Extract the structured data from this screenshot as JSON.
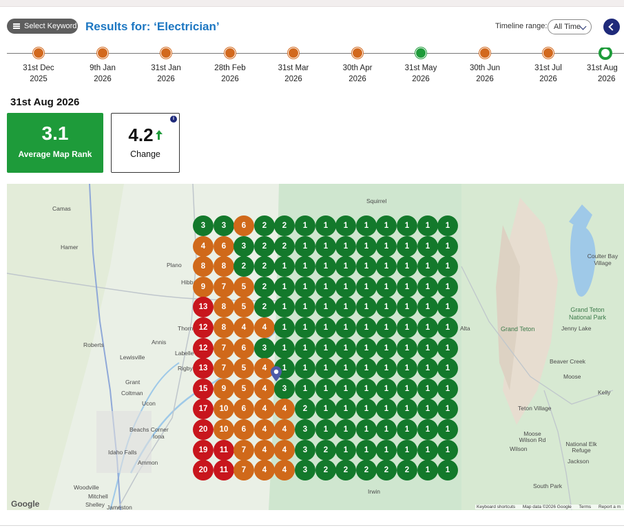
{
  "header": {
    "select_keyword_label": "Select Keyword",
    "results_title": "Results for: ‘Electrician’",
    "timeline_range_label": "Timeline range:",
    "timeline_range_value": "All Time"
  },
  "timeline": [
    {
      "line1": "31st Dec",
      "line2": "2025",
      "status": "orange"
    },
    {
      "line1": "9th Jan",
      "line2": "2026",
      "status": "orange"
    },
    {
      "line1": "31st Jan",
      "line2": "2026",
      "status": "orange"
    },
    {
      "line1": "28th Feb",
      "line2": "2026",
      "status": "orange"
    },
    {
      "line1": "31st Mar",
      "line2": "2026",
      "status": "orange"
    },
    {
      "line1": "30th Apr",
      "line2": "2026",
      "status": "orange"
    },
    {
      "line1": "31st May",
      "line2": "2026",
      "status": "green"
    },
    {
      "line1": "30th Jun",
      "line2": "2026",
      "status": "orange"
    },
    {
      "line1": "31st Jul",
      "line2": "2026",
      "status": "orange"
    },
    {
      "line1": "31st Aug",
      "line2": "2026",
      "status": "selected"
    }
  ],
  "selected_date": "31st Aug 2026",
  "metrics": {
    "average_map_rank_value": "3.1",
    "average_map_rank_label": "Average Map Rank",
    "change_value": "4.2",
    "change_label": "Change",
    "info_glyph": "i"
  },
  "colors": {
    "green": "#13792b",
    "orange": "#d0691a",
    "red": "#c8161d"
  },
  "rank_grid": [
    [
      "3",
      "3",
      "6",
      "2",
      "2",
      "1",
      "1",
      "1",
      "1",
      "1",
      "1",
      "1",
      "1"
    ],
    [
      "4",
      "6",
      "3",
      "2",
      "2",
      "1",
      "1",
      "1",
      "1",
      "1",
      "1",
      "1",
      "1"
    ],
    [
      "8",
      "8",
      "2",
      "2",
      "1",
      "1",
      "1",
      "1",
      "1",
      "1",
      "1",
      "1",
      "1"
    ],
    [
      "9",
      "7",
      "5",
      "2",
      "1",
      "1",
      "1",
      "1",
      "1",
      "1",
      "1",
      "1",
      "1"
    ],
    [
      "13",
      "8",
      "5",
      "2",
      "1",
      "1",
      "1",
      "1",
      "1",
      "1",
      "1",
      "1",
      "1"
    ],
    [
      "12",
      "8",
      "4",
      "4",
      "1",
      "1",
      "1",
      "1",
      "1",
      "1",
      "1",
      "1",
      "1"
    ],
    [
      "12",
      "7",
      "6",
      "3",
      "1",
      "1",
      "1",
      "1",
      "1",
      "1",
      "1",
      "1",
      "1"
    ],
    [
      "13",
      "7",
      "5",
      "4",
      "1",
      "1",
      "1",
      "1",
      "1",
      "1",
      "1",
      "1",
      "1"
    ],
    [
      "15",
      "9",
      "5",
      "4",
      "3",
      "1",
      "1",
      "1",
      "1",
      "1",
      "1",
      "1",
      "1"
    ],
    [
      "17",
      "10",
      "6",
      "4",
      "4",
      "2",
      "1",
      "1",
      "1",
      "1",
      "1",
      "1",
      "1"
    ],
    [
      "20",
      "10",
      "6",
      "4",
      "4",
      "3",
      "1",
      "1",
      "1",
      "1",
      "1",
      "1",
      "1"
    ],
    [
      "19",
      "11",
      "7",
      "4",
      "4",
      "3",
      "2",
      "1",
      "1",
      "1",
      "1",
      "1",
      "1"
    ],
    [
      "20",
      "11",
      "7",
      "4",
      "4",
      "3",
      "2",
      "2",
      "2",
      "2",
      "2",
      "1",
      "1"
    ]
  ],
  "map_labels": [
    "Camas",
    "Squirrel",
    "Hamer",
    "Plano",
    "Hibbard",
    "Roberts",
    "Lewisville",
    "Annis",
    "Thornton",
    "Labelle",
    "Rigby",
    "Grant",
    "Coltman",
    "Ucon",
    "Beachs Corner",
    "Iona",
    "Idaho Falls",
    "Ammon",
    "Woodville",
    "Mitchell",
    "Shelley",
    "Jameston",
    "Irwin",
    "Alta",
    "Coulter Bay Village",
    "Grand Teton National Park",
    "Grand Teton",
    "Jenny Lake",
    "Beaver Creek",
    "Moose",
    "Kelly",
    "Teton Village",
    "Moose Wilson Rd",
    "Wilson",
    "National Elk Refuge",
    "South Park",
    "Jackson"
  ],
  "map_footer": {
    "google": "Google",
    "shortcuts": "Keyboard shortcuts",
    "map_data": "Map data ©2026 Google",
    "terms": "Terms",
    "report": "Report a m"
  }
}
